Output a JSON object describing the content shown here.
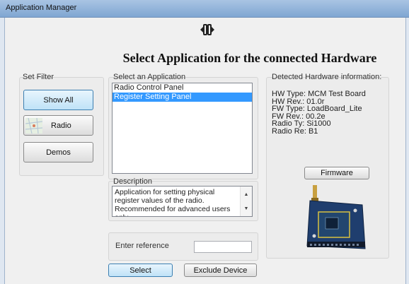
{
  "window": {
    "title": "Application Manager"
  },
  "heading": "Select Application for the connected Hardware",
  "filter": {
    "label": "Set Filter",
    "buttons": {
      "show_all": "Show All",
      "radio": "Radio",
      "demos": "Demos"
    }
  },
  "applications": {
    "label": "Select an Application",
    "items": [
      "Radio Control Panel",
      "Register Setting Panel"
    ],
    "selected_index": 1
  },
  "hardware": {
    "label": "Detected Hardware information:",
    "lines": [
      "HW Type: MCM Test Board",
      "HW Rev.: 01.0r",
      "FW Type: LoadBoard_Lite",
      "FW Rev.: 00.2e",
      "Radio Ty: Si1000",
      "Radio Re: B1"
    ],
    "firmware_button": "Firmware"
  },
  "description": {
    "label": "Description",
    "text": "Application for setting physical register values of the radio. Recommended for advanced users only."
  },
  "reference": {
    "label": "Enter reference",
    "value": ""
  },
  "actions": {
    "select": "Select",
    "exclude": "Exclude Device"
  }
}
